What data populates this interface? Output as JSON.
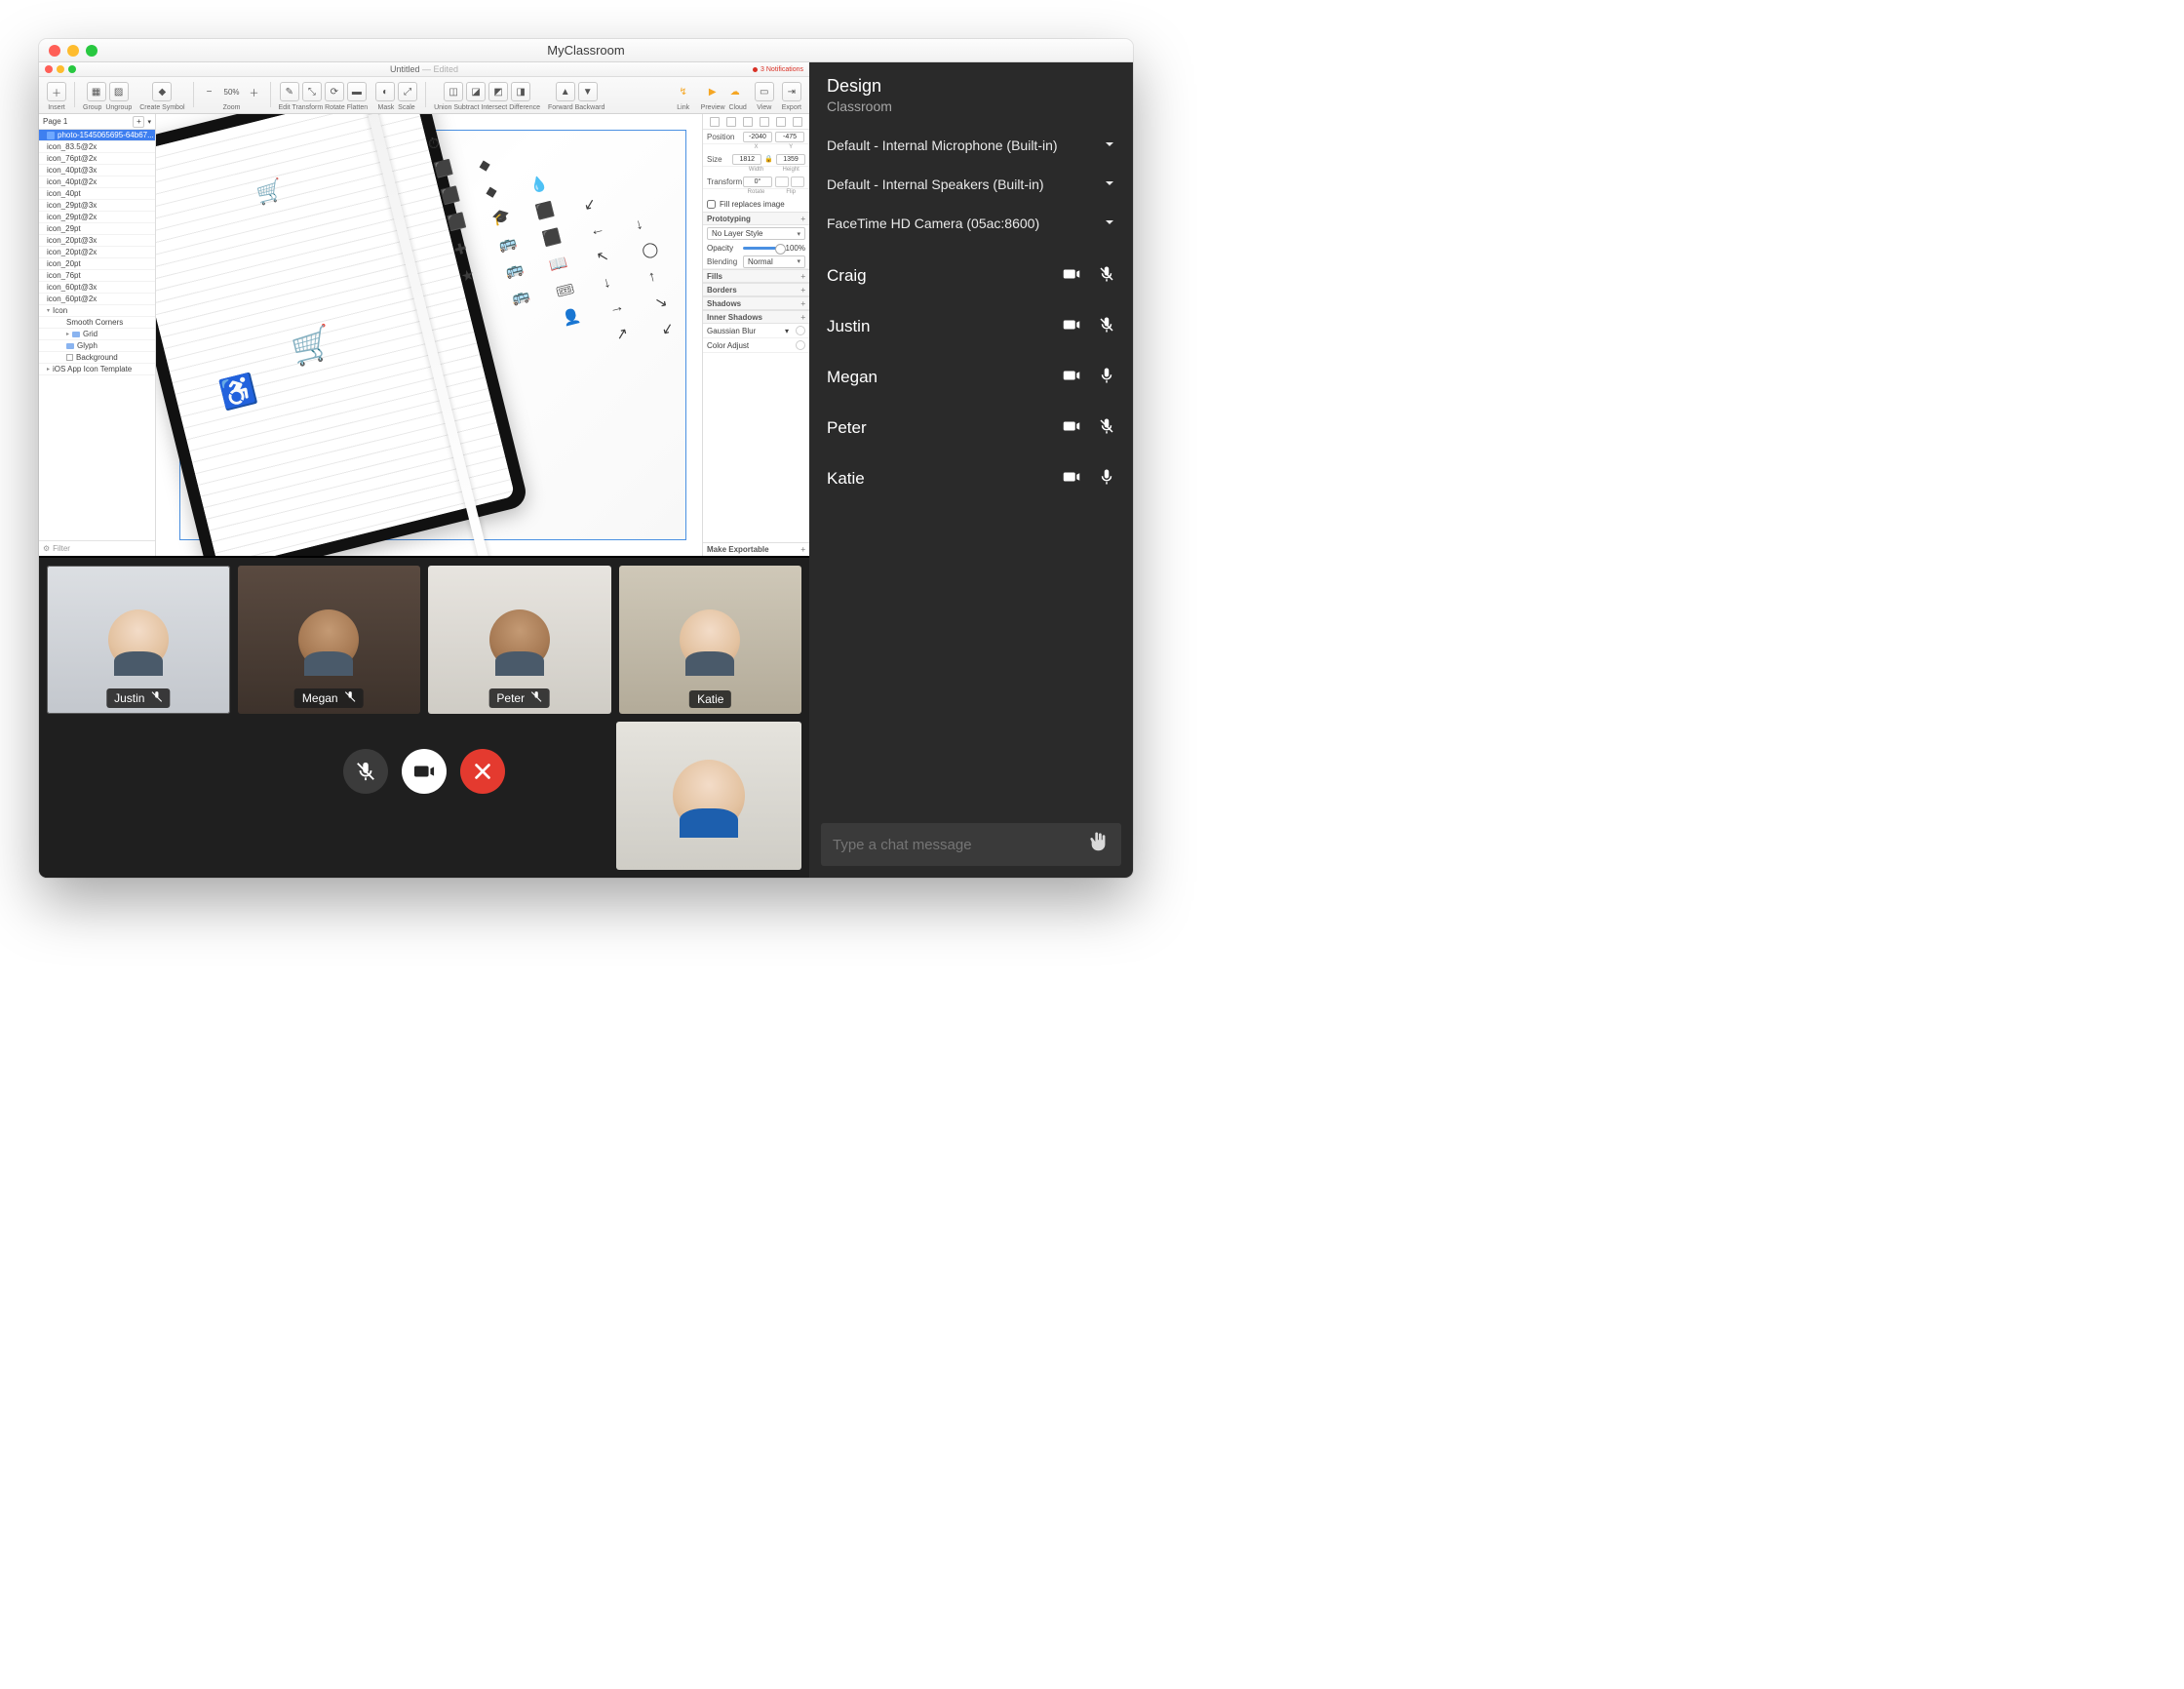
{
  "window_title": "MyClassroom",
  "shared_app": {
    "title": "Untitled",
    "status": "Edited",
    "notifications": "3 Notifications",
    "page_selector": "Page 1",
    "filter_placeholder": "Filter",
    "zoom_label": "50%",
    "toolbar": {
      "insert": "Insert",
      "group": "Group",
      "ungroup": "Ungroup",
      "create_symbol": "Create Symbol",
      "zoom": "Zoom",
      "edit": "Edit",
      "transform": "Transform",
      "rotate": "Rotate",
      "flatten": "Flatten",
      "mask": "Mask",
      "scale": "Scale",
      "union": "Union",
      "subtract": "Subtract",
      "intersect": "Intersect",
      "difference": "Difference",
      "forward": "Forward",
      "backward": "Backward",
      "link": "Link",
      "preview": "Preview",
      "cloud": "Cloud",
      "view": "View",
      "export": "Export"
    },
    "layers": [
      {
        "label": "photo-1545065695-64b67...",
        "selected": true,
        "icon": "img"
      },
      {
        "label": "icon_83.5@2x"
      },
      {
        "label": "icon_76pt@2x"
      },
      {
        "label": "icon_40pt@3x"
      },
      {
        "label": "icon_40pt@2x"
      },
      {
        "label": "icon_40pt"
      },
      {
        "label": "icon_29pt@3x"
      },
      {
        "label": "icon_29pt@2x"
      },
      {
        "label": "icon_29pt"
      },
      {
        "label": "icon_20pt@3x"
      },
      {
        "label": "icon_20pt@2x"
      },
      {
        "label": "icon_20pt"
      },
      {
        "label": "icon_76pt"
      },
      {
        "label": "icon_60pt@3x"
      },
      {
        "label": "icon_60pt@2x"
      },
      {
        "label": "Icon",
        "expandable": true,
        "expanded": true
      },
      {
        "label": "Smooth Corners",
        "indent": 2
      },
      {
        "label": "Grid",
        "indent": 2,
        "expandable": true,
        "icon": "folder"
      },
      {
        "label": "Glyph",
        "indent": 2,
        "icon": "folder"
      },
      {
        "label": "Background",
        "indent": 2,
        "icon": "sq"
      },
      {
        "label": "iOS App Icon Template",
        "expandable": true
      }
    ],
    "inspector": {
      "position_label": "Position",
      "position_x": "-2040",
      "position_y": "-475",
      "x_label": "X",
      "y_label": "Y",
      "size_label": "Size",
      "width": "1812",
      "height": "1359",
      "width_label": "Width",
      "height_label": "Height",
      "transform_label": "Transform",
      "rotate_val": "0°",
      "rotate_label": "Rotate",
      "flip_label": "Flip",
      "fill_replaces": "Fill replaces image",
      "prototyping": "Prototyping",
      "no_layer_style": "No Layer Style",
      "opacity_label": "Opacity",
      "opacity_val": "100%",
      "blending_label": "Blending",
      "blending_val": "Normal",
      "fills": "Fills",
      "borders": "Borders",
      "shadows": "Shadows",
      "inner_shadows": "Inner Shadows",
      "gaussian": "Gaussian Blur",
      "color_adjust": "Color Adjust",
      "make_exportable": "Make Exportable"
    }
  },
  "video_tiles": [
    {
      "name": "Justin",
      "muted": true,
      "bg": "bg-office",
      "skin": "pale"
    },
    {
      "name": "Megan",
      "muted": true,
      "bg": "bg-room",
      "skin": "dark"
    },
    {
      "name": "Peter",
      "muted": true,
      "bg": "bg-door",
      "skin": "dark"
    },
    {
      "name": "Katie",
      "muted": false,
      "bg": "bg-open",
      "skin": "pale"
    }
  ],
  "sidebar": {
    "title": "Design",
    "subtitle": "Classroom",
    "mic": "Default - Internal Microphone (Built-in)",
    "speaker": "Default - Internal Speakers (Built-in)",
    "camera": "FaceTime HD Camera (05ac:8600)",
    "participants": [
      {
        "name": "Craig",
        "camera": true,
        "muted": true
      },
      {
        "name": "Justin",
        "camera": true,
        "muted": true
      },
      {
        "name": "Megan",
        "camera": true,
        "muted": false
      },
      {
        "name": "Peter",
        "camera": true,
        "muted": true
      },
      {
        "name": "Katie",
        "camera": true,
        "muted": false
      }
    ],
    "chat_placeholder": "Type a chat message"
  }
}
